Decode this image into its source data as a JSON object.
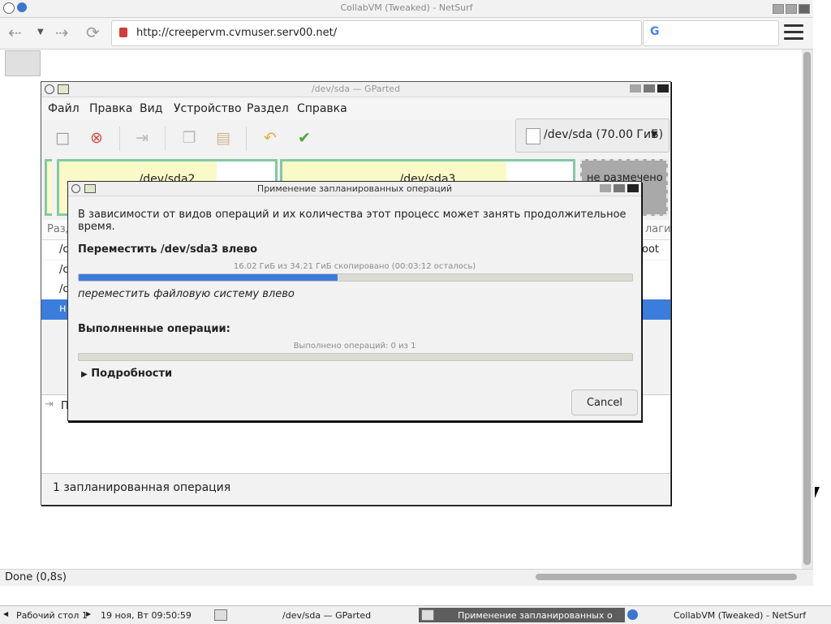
{
  "browser": {
    "window_title": "CollabVM (Tweaked) - NetSurf",
    "url": "http://creepervm.cvmuser.serv00.net/",
    "search_placeholder": "",
    "status": "Done (0,8s)"
  },
  "gparted": {
    "window_title": "/dev/sda — GParted",
    "menu": [
      "Файл",
      "Правка",
      "Вид",
      "Устройство",
      "Раздел",
      "Справка"
    ],
    "device": "/dev/sda (70.00 ГиБ)",
    "graph": {
      "part1": "/dev/sda2",
      "part2": "/dev/sda3",
      "unallocated": "не размечено"
    },
    "list_header": {
      "col1": "Разд",
      "col_last": "лаги"
    },
    "rows": [
      {
        "c1": "/c",
        "flag": "oot"
      },
      {
        "c1": "/c",
        "flag": ""
      },
      {
        "c1": "/c",
        "flag": ""
      },
      {
        "c1": "н",
        "flag": ""
      }
    ],
    "pending_label": "П",
    "status": "1 запланированная операция"
  },
  "dialog": {
    "title": "Применение запланированных операций",
    "intro": "В зависимости от видов операций и их количества этот процесс может занять продолжительное время.",
    "operation_title": "Переместить /dev/sda3 влево",
    "operation_progress_text": "16.02 ГиБ из 34.21 ГиБ скопировано (00:03:12 осталось)",
    "operation_progress_fraction": 0.468,
    "operation_sub": "переместить файловую систему влево",
    "completed_title": "Выполненные операции:",
    "completed_text": "Выполнено операций: 0 из 1",
    "completed_fraction": 0,
    "details_label": "Подробности",
    "cancel_label": "Cancel"
  },
  "taskbar": {
    "workspace": "Рабочий стол 1",
    "clock": "19 ноя, Вт 09:50:59",
    "task_gparted": "/dev/sda — GParted",
    "task_dialog": "Применение запланированных о",
    "task_browser": "CollabVM (Tweaked) - NetSurf"
  },
  "colors": {
    "accent": "#3b7ddd",
    "partition_border": "#83c9a6",
    "partition_fill": "#fafac8",
    "unallocated": "#a9a9a9"
  }
}
